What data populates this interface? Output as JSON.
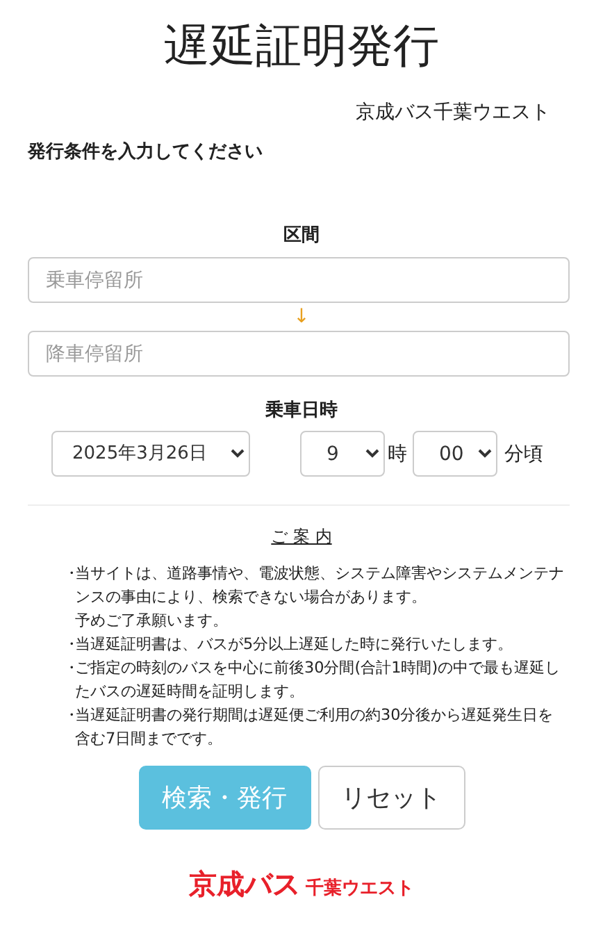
{
  "title": "遅延証明発行",
  "company": "京成バス千葉ウエスト",
  "instruction": "発行条件を入力してください",
  "section": {
    "label": "区間",
    "from": {
      "placeholder": "乗車停留所"
    },
    "arrow": "↓",
    "to": {
      "placeholder": "降車停留所"
    }
  },
  "datetime": {
    "label": "乗車日時",
    "date": "2025年3月26日",
    "hour": "9",
    "hour_unit": "時",
    "minute": "00",
    "minute_unit": "分頃"
  },
  "notice": {
    "heading": "ご 案 内",
    "lines": [
      {
        "bullet": "・",
        "text": "当サイトは、道路事情や、電波状態、システム障害やシステムメンテナンスの事由により、検索できない場合があります。"
      },
      {
        "text": "予めご了承願います。"
      },
      {
        "bullet": "・",
        "text": "当遅延証明書は、バスが5分以上遅延した時に発行いたします。"
      },
      {
        "bullet": "・",
        "text": "ご指定の時刻のバスを中心に前後30分間(合計1時間)の中で最も遅延したバスの遅延時間を証明します。"
      },
      {
        "bullet": "・",
        "text": "当遅延証明書の発行期間は遅延便ご利用の約30分後から遅延発生日を含む7日間までです。"
      }
    ]
  },
  "buttons": [
    {
      "label": "検索・発行",
      "kind": "primary"
    },
    {
      "label": "リセット",
      "kind": "secondary"
    }
  ],
  "logo": {
    "main": "京成バス",
    "sub": "千葉ウエスト"
  }
}
